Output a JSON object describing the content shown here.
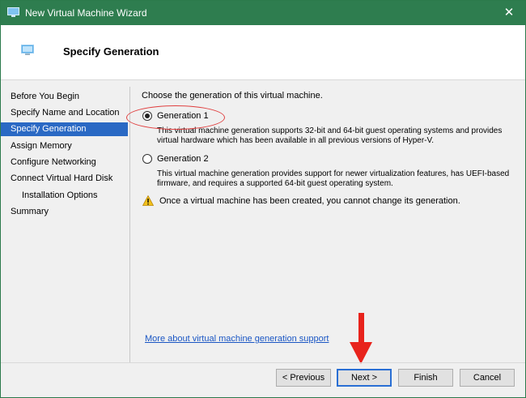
{
  "window": {
    "title": "New Virtual Machine Wizard",
    "close_glyph": "✕",
    "accent_color": "#2e7d4f"
  },
  "header": {
    "title": "Specify Generation"
  },
  "sidebar": {
    "items": [
      {
        "label": "Before You Begin"
      },
      {
        "label": "Specify Name and Location"
      },
      {
        "label": "Specify Generation"
      },
      {
        "label": "Assign Memory"
      },
      {
        "label": "Configure Networking"
      },
      {
        "label": "Connect Virtual Hard Disk"
      },
      {
        "label": "Installation Options"
      },
      {
        "label": "Summary"
      }
    ],
    "active_item": "Specify Generation"
  },
  "main": {
    "prompt": "Choose the generation of this virtual machine.",
    "options": [
      {
        "label": "Generation 1",
        "selected": true,
        "desc1": "This virtual machine generation supports 32-bit and 64-bit guest operating systems and provides",
        "desc2": "virtual hardware which has been available in all previous versions of Hyper-V."
      },
      {
        "label": "Generation 2",
        "selected": false,
        "desc1": "This virtual machine generation provides support for newer virtualization features, has UEFI-based",
        "desc2": "firmware, and requires a supported 64-bit guest operating system."
      }
    ],
    "warning": "Once a virtual machine has been created, you cannot change its generation.",
    "link": "More about virtual machine generation support"
  },
  "buttons": {
    "previous": "< Previous",
    "next": "Next >",
    "finish": "Finish",
    "cancel": "Cancel"
  },
  "annotation_colors": {
    "highlight": "#e04040",
    "arrow": "#e8231c"
  }
}
